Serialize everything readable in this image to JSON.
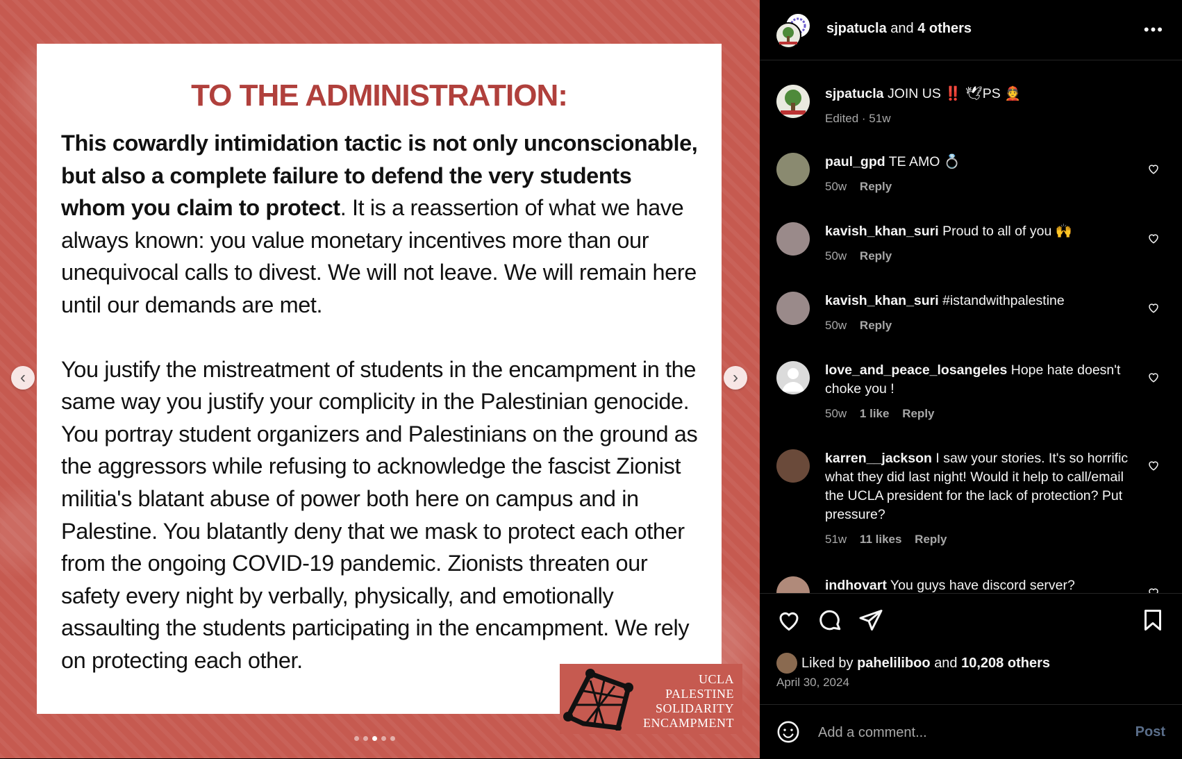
{
  "slide": {
    "title": "TO THE ADMINISTRATION:",
    "p1_bold": "This cowardly intimidation tactic is not only unconscionable, but also a complete failure to defend the very students whom you claim to protect",
    "p1_rest": ". It is a reassertion of what we have always known: you value monetary incentives more than our unequivocal calls to divest. We will not leave. We will remain here until our demands are met.",
    "p2": "You justify the mistreatment of students in the encampment in the same way you justify your complicity in the Palestinian genocide. You portray student organizers and Palestinians on the ground as the aggressors while refusing to acknowledge the fascist Zionist militia's blatant abuse of power both here on campus and in Palestine. You blatantly deny that we mask to protect each other from the ongoing COVID-19 pandemic. Zionists threaten our safety every night by verbally, physically, and emotionally assaulting the students participating in the encampment. We rely on protecting each other.",
    "logo_lines": [
      "UCLA",
      "PALESTINE",
      "SOLIDARITY",
      "ENCAMPMENT"
    ],
    "dots_total": 5,
    "dots_active": 3
  },
  "header": {
    "user": "sjpatucla",
    "and": "and",
    "others": "4 others",
    "more_icon": "more-horizontal-icon"
  },
  "caption": {
    "user": "sjpatucla",
    "text": "JOIN US ‼️ 🕊PS 👲",
    "meta": "Edited · 51w"
  },
  "comments": [
    {
      "user": "paul_gpd",
      "text": "TE AMO 💍",
      "time": "50w",
      "likes": "",
      "reply": "Reply"
    },
    {
      "user": "kavish_khan_suri",
      "text": "Proud to all of you 🙌",
      "time": "50w",
      "likes": "",
      "reply": "Reply"
    },
    {
      "user": "kavish_khan_suri",
      "text": "#istandwithpalestine",
      "time": "50w",
      "likes": "",
      "reply": "Reply"
    },
    {
      "user": "love_and_peace_losangeles",
      "text": "Hope hate doesn't choke you !",
      "time": "50w",
      "likes": "1 like",
      "reply": "Reply"
    },
    {
      "user": "karren__jackson",
      "text": "I saw your stories. It's so horrific what they did last night! Would it help to call/email the UCLA president for the lack of protection? Put pressure?",
      "time": "51w",
      "likes": "11 likes",
      "reply": "Reply"
    },
    {
      "user": "indhovart",
      "text": "You guys have discord server?",
      "time": "",
      "likes": "",
      "reply": ""
    }
  ],
  "likes": {
    "prefix": "Liked by",
    "user": "paheliliboo",
    "and": "and",
    "others": "10,208 others"
  },
  "date": "April 30, 2024",
  "add_comment": {
    "placeholder": "Add a comment...",
    "post": "Post"
  }
}
